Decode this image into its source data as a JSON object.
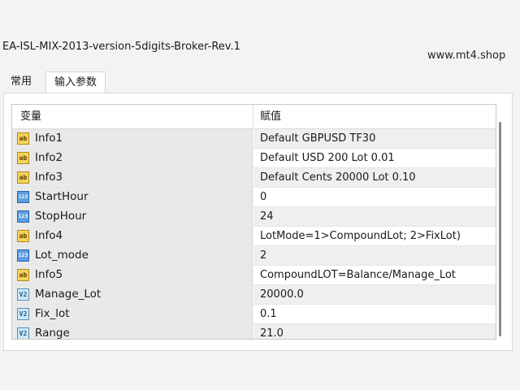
{
  "window": {
    "title": "EA-ISL-MIX-2013-version-5digits-Broker-Rev.1",
    "watermark": "www.mt4.shop"
  },
  "tabs": [
    {
      "label": "常用",
      "active": false
    },
    {
      "label": "输入参数",
      "active": true
    }
  ],
  "table": {
    "headers": {
      "variable": "变量",
      "value": "赋值"
    },
    "rows": [
      {
        "icon": "string-type-icon",
        "name": "Info1",
        "value": "Default GBPUSD TF30"
      },
      {
        "icon": "string-type-icon",
        "name": "Info2",
        "value": "Default USD 200 Lot 0.01"
      },
      {
        "icon": "string-type-icon",
        "name": "Info3",
        "value": "Default Cents 20000 Lot 0.10"
      },
      {
        "icon": "integer-type-icon",
        "name": "StartHour",
        "value": "0"
      },
      {
        "icon": "integer-type-icon",
        "name": "StopHour",
        "value": "24"
      },
      {
        "icon": "string-type-icon",
        "name": "Info4",
        "value": "LotMode=1>CompoundLot; 2>FixLot)"
      },
      {
        "icon": "integer-type-icon",
        "name": "Lot_mode",
        "value": "2"
      },
      {
        "icon": "string-type-icon",
        "name": "Info5",
        "value": "CompoundLOT=Balance/Manage_Lot"
      },
      {
        "icon": "double-type-icon",
        "name": "Manage_Lot",
        "value": "20000.0"
      },
      {
        "icon": "double-type-icon",
        "name": "Fix_lot",
        "value": "0.1"
      },
      {
        "icon": "double-type-icon",
        "name": "Range",
        "value": "21.0"
      }
    ]
  },
  "icon_glyphs": {
    "string-type-icon": "ab",
    "integer-type-icon": "123",
    "double-type-icon": "V2"
  }
}
